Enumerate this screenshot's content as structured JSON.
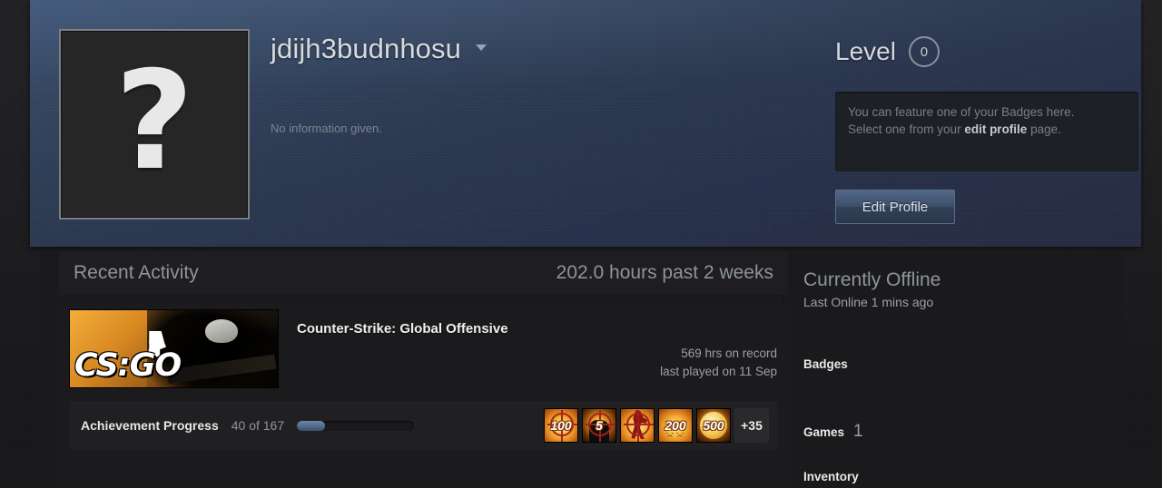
{
  "profile": {
    "avatar_icon": "question-mark-avatar",
    "persona_name": "jdijh3budnhosu",
    "summary": "No information given.",
    "level_label": "Level",
    "level_value": "0",
    "badge_notice_line1": "You can feature one of your Badges here.",
    "badge_notice_line2_pre": "Select one from your ",
    "badge_notice_link": "edit profile",
    "badge_notice_line2_post": " page.",
    "edit_profile_label": "Edit Profile"
  },
  "recent_activity": {
    "title": "Recent Activity",
    "hours_meta": "202.0 hours past 2 weeks",
    "game": {
      "name": "Counter-Strike: Global Offensive",
      "capsule_logo": "CS:GO",
      "hours_on_record": "569 hrs on record",
      "last_played": "last played on 11 Sep"
    },
    "achievements": {
      "label": "Achievement Progress",
      "count_text": "40 of 167",
      "unlocked": 40,
      "total": 167,
      "percent": 24,
      "icons": [
        {
          "name": "achievement-100-crosshair",
          "text": "100"
        },
        {
          "name": "achievement-5-target",
          "text": "5"
        },
        {
          "name": "achievement-figure-crosshair",
          "text": ""
        },
        {
          "name": "achievement-200-stars",
          "text": "200"
        },
        {
          "name": "achievement-500-disc",
          "text": "500"
        }
      ],
      "more_label": "+35"
    }
  },
  "sidebar": {
    "status_title": "Currently Offline",
    "last_online": "Last Online 1 mins ago",
    "badges_label": "Badges",
    "games_label": "Games",
    "games_count": "1",
    "inventory_label": "Inventory"
  },
  "colors": {
    "header_blue": "#2b3850",
    "accent_button": "#3d4f6b",
    "panel_dark": "#1a1a1c",
    "text_muted": "#8d949c"
  }
}
